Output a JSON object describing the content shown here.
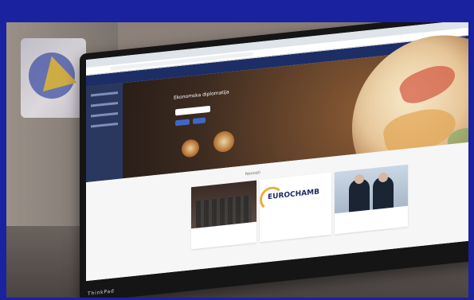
{
  "screen": {
    "nav_items": [
      "",
      "",
      "",
      "",
      "",
      "",
      "",
      "",
      ""
    ],
    "hero": {
      "title": "Ekonomska diplomatija"
    },
    "news": {
      "heading": "Novosti",
      "card2_logo": "EUROCHAMB"
    },
    "brand": "ThinkPad"
  }
}
